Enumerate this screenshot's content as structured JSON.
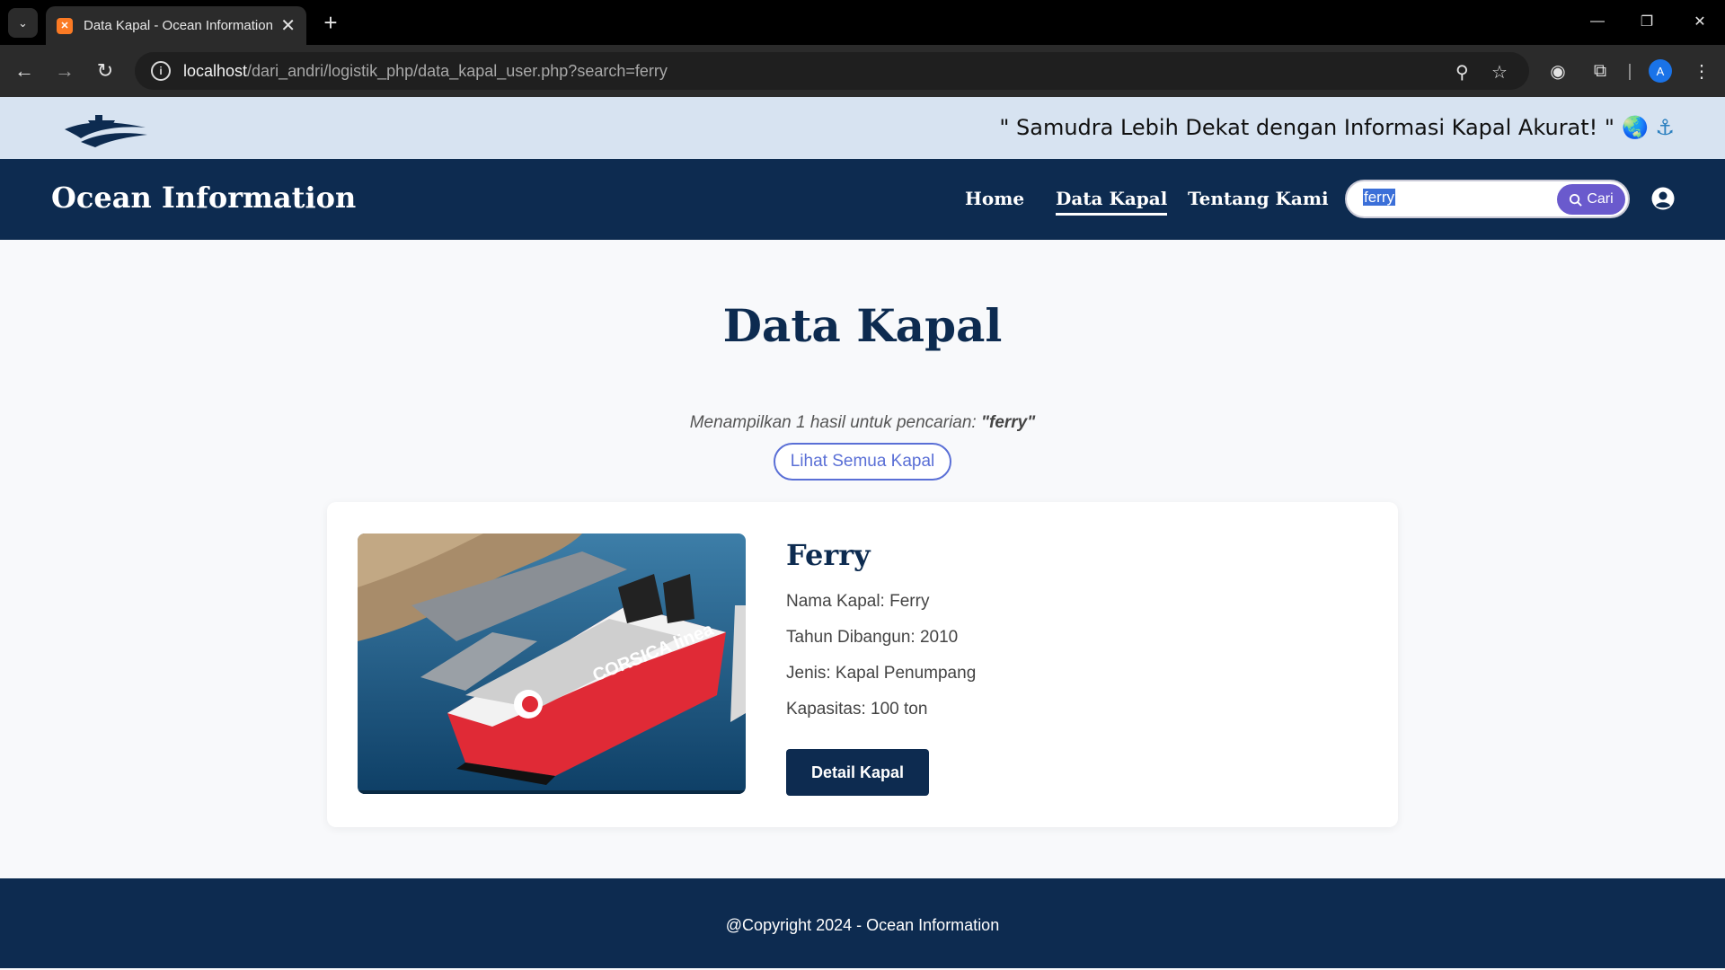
{
  "browser": {
    "tab_title": "Data Kapal - Ocean Information",
    "url_host": "localhost",
    "url_path": "/dari_andri/logistik_php/data_kapal_user.php?search=ferry",
    "profile_initial": "A"
  },
  "site": {
    "tagline": "\" Samudra Lebih Dekat dengan Informasi Kapal Akurat! \"",
    "tagline_emoji": "🌏 ⚓",
    "brand": "Ocean Information",
    "nav": {
      "home": "Home",
      "data_kapal": "Data Kapal",
      "tentang": "Tentang Kami"
    },
    "search": {
      "value": "ferry",
      "button_label": "Cari"
    }
  },
  "main": {
    "heading": "Data Kapal",
    "result_prefix": "Menampilkan 1 hasil untuk pencarian:",
    "result_query": "\"ferry\"",
    "see_all_label": "Lihat Semua Kapal"
  },
  "ship": {
    "title": "Ferry",
    "nama": "Nama Kapal: Ferry",
    "tahun": "Tahun Dibangun: 2010",
    "jenis": "Jenis: Kapal Penumpang",
    "kapasitas": "Kapasitas: 100 ton",
    "detail_label": "Detail Kapal",
    "image_hull_text": "CORSICA linea"
  },
  "footer": {
    "copyright": "@Copyright 2024 - Ocean Information"
  },
  "colors": {
    "navy": "#0d2b50",
    "accent": "#6a5acd",
    "strip": "#d7e3f1"
  }
}
